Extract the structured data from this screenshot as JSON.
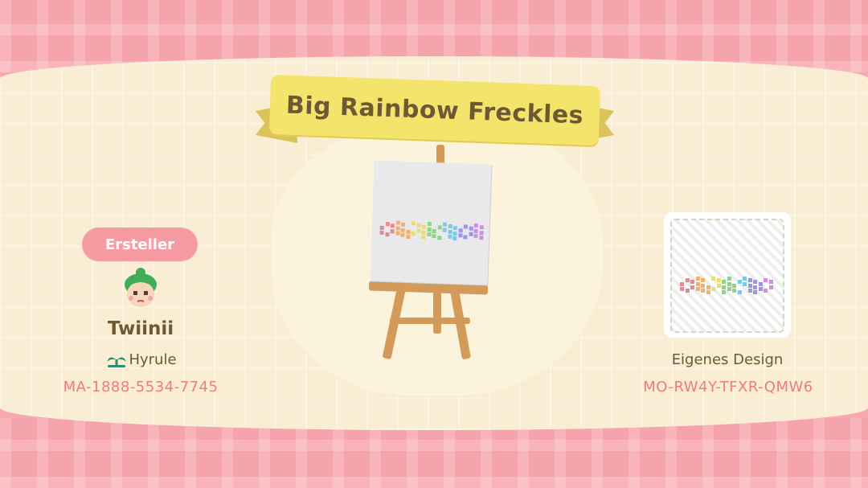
{
  "title": "Big Rainbow Freckles",
  "creator": {
    "label": "Ersteller",
    "name": "Twiinii",
    "island": "Hyrule",
    "id": "MA-1888-5534-7745"
  },
  "design": {
    "type": "Eigenes Design",
    "code": "MO-RW4Y-TFXR-QMW6"
  },
  "icons": {
    "avatar": "villager-avatar-icon",
    "island": "island-sprout-icon"
  },
  "colors": {
    "pink_band": "#f6a4ab",
    "cream": "#f9edd3",
    "ribbon": "#f4e46b",
    "text_brown": "#6d5a35",
    "text_pink": "#ec7c82",
    "rainbow": [
      "#e9898f",
      "#f0b070",
      "#e7de6e",
      "#8ed582",
      "#7cc8e8",
      "#9f93e8",
      "#d08fe0"
    ]
  }
}
